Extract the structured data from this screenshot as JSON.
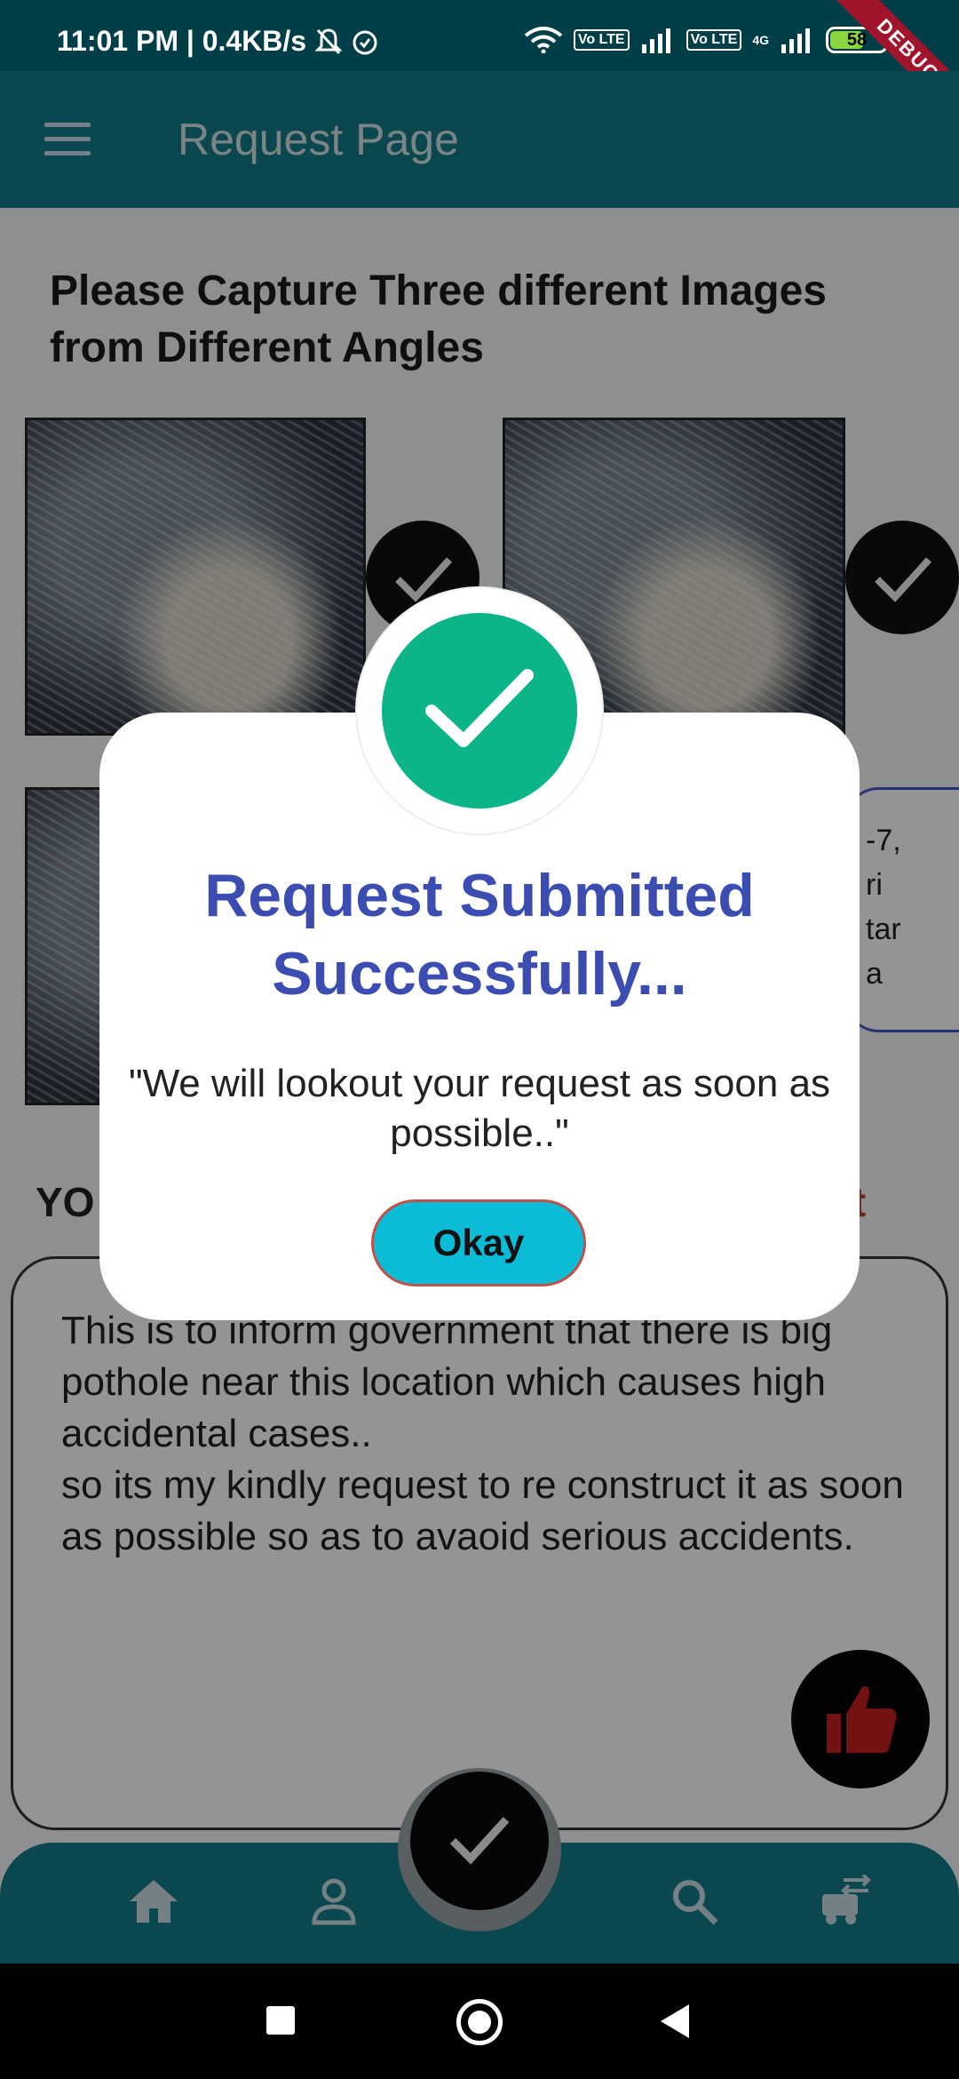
{
  "status_bar": {
    "time_speed": "11:01 PM | 0.4KB/s",
    "sim1_label": "Vo LTE",
    "sim2_label": "Vo LTE",
    "network_label": "4G",
    "battery": "58",
    "debug_banner": "DEBUG"
  },
  "app_bar": {
    "title": "Request Page"
  },
  "page": {
    "heading": "Please Capture Three different Images from Different Angles",
    "address_snippet": "-7,\nri\ntar\na",
    "section_label_left": "YO",
    "section_label_right": "t",
    "request_text": "This is to inform government that there is big pothole near this location which causes high accidental cases..\nso its my kindly request to re construct it as soon as possible so as to avaoid serious accidents."
  },
  "dialog": {
    "title": "Request Submitted Successfully...",
    "message": "\"We will  lookout your request as soon as possible..\"",
    "okay_label": "Okay"
  },
  "colors": {
    "app_bar": "#137a88",
    "status_bar": "#003f47",
    "dialog_title": "#3c4db2",
    "success_badge": "#0cb48a",
    "okay_button": "#0bbcd6"
  },
  "icons": [
    "menu-icon",
    "check-icon",
    "thumbs-up-icon",
    "home-icon",
    "person-icon",
    "search-icon",
    "vehicle-icon"
  ]
}
